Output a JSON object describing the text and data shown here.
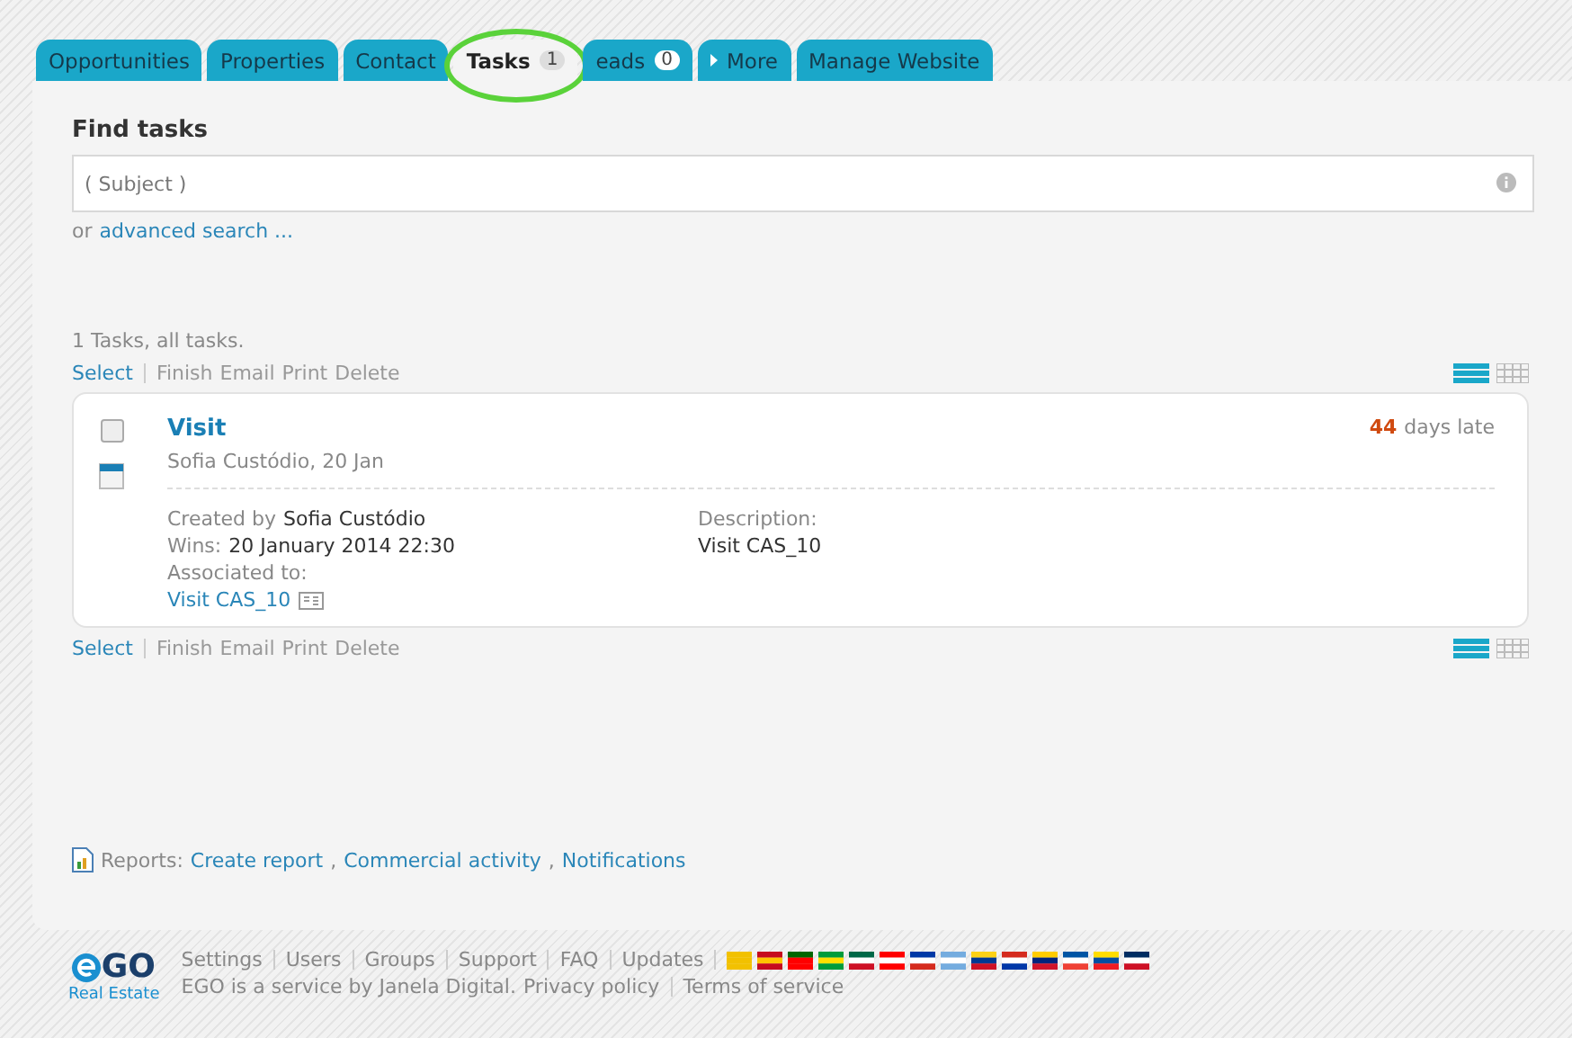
{
  "tabs": [
    {
      "label": "Opportunities",
      "selected": false
    },
    {
      "label": "Properties",
      "selected": false
    },
    {
      "label": "Contact",
      "selected": false
    },
    {
      "label": "Tasks",
      "badge": "1",
      "selected": true
    },
    {
      "label": "eads",
      "badge": "0",
      "selected": false
    },
    {
      "label": "More",
      "kind": "menu",
      "selected": false
    },
    {
      "label": "Manage Website",
      "selected": false
    }
  ],
  "search": {
    "heading": "Find tasks",
    "placeholder": "( Subject )",
    "prefix": "or",
    "advanced_link": "advanced search ..."
  },
  "summary": "1 Tasks, all tasks.",
  "toolbars": [
    {
      "select": "Select",
      "actions": [
        "Finish",
        "Email",
        "Print",
        "Delete"
      ]
    },
    {
      "select": "Select",
      "actions": [
        "Finish",
        "Email",
        "Print",
        "Delete"
      ]
    }
  ],
  "tasks": [
    {
      "title": "Visit",
      "checked": false,
      "subtitle": "Sofia Custódio, 20 Jan",
      "late_count": "44",
      "late_text": "days late",
      "created_label": "Created by",
      "created_by": "Sofia Custódio",
      "wins_label": "Wins:",
      "wins": "20 January 2014 22:30",
      "associated_label": "Associated to:",
      "associated": "Visit CAS_10",
      "description_label": "Description:",
      "description": "Visit CAS_10"
    }
  ],
  "reports": {
    "label": "Reports:",
    "separator": ",",
    "links": [
      "Create report",
      "Commercial activity",
      "Notifications"
    ]
  },
  "footer": {
    "logo": "GO",
    "logo_sub": "Real Estate",
    "links": [
      "Settings",
      "Users",
      "Groups",
      "Support",
      "FAQ",
      "Updates"
    ],
    "credit": "EGO is a service by Janela Digital.",
    "legal": [
      "Privacy policy",
      "Terms of service"
    ]
  }
}
